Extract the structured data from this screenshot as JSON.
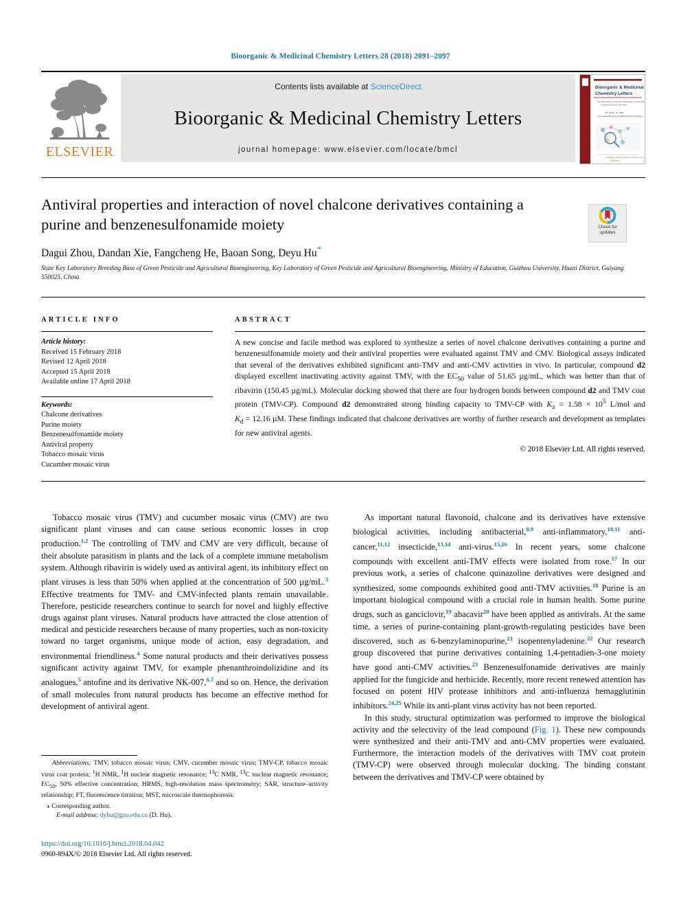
{
  "running_head": "Bioorganic & Medicinal Chemistry Letters 28 (2018) 2091–2097",
  "colors": {
    "link": "#1a72a8",
    "elsevier_orange": "#E87722",
    "sciencedirect_blue": "#3a8dc4",
    "band_gray": "#e6e6e6"
  },
  "masthead": {
    "contents_prefix": "Contents lists available at ",
    "sciencedirect": "ScienceDirect",
    "journal_title": "Bioorganic & Medicinal Chemistry Letters",
    "homepage": "journal homepage: www.elsevier.com/locate/bmcl",
    "publisher": "ELSEVIER",
    "cover_title_line1": "Bioorganic & Medicinal",
    "cover_title_line2": "Chemistry Letters",
    "cover_footer": "Elsevier"
  },
  "article": {
    "title": "Antiviral properties and interaction of novel chalcone derivatives containing a purine and benzenesulfonamide moiety",
    "authors": "Dagui Zhou, Dandan Xie, Fangcheng He, Baoan Song, Deyu Hu",
    "corresponding_marker": "*",
    "affiliation": "State Key Laboratory Breeding Base of Green Pesticide and Agricultural Bioengineering, Key Laboratory of Green Pesticide and Agricultural Bioengineering, Ministry of Education, Guizhou University, Huaxi District, Guiyang 550025, China",
    "crossmark_label_line1": "Check for",
    "crossmark_label_line2": "updates"
  },
  "article_info": {
    "heading": "ARTICLE INFO",
    "history_label": "Article history:",
    "history": [
      "Received 15 February 2018",
      "Revised 12 April 2018",
      "Accepted 15 April 2018",
      "Available online 17 April 2018"
    ],
    "keywords_label": "Keywords:",
    "keywords": [
      "Chalcone derivatives",
      "Purine moiety",
      "Benzenesulfonamide moiety",
      "Antiviral property",
      "Tobacco mosaic virus",
      "Cucumber mosaic virus"
    ]
  },
  "abstract": {
    "heading": "ABSTRACT",
    "copyright": "© 2018 Elsevier Ltd. All rights reserved."
  },
  "footnotes": {
    "abbreviations_label": "Abbreviations:",
    "corresponding": "Corresponding author.",
    "email_label": "E-mail address:",
    "email": "dyhu@gzu.edu.cn",
    "email_suffix": "(D. Hu).",
    "doi": "https://doi.org/10.1016/j.bmcl.2018.04.042",
    "issn_line": "0960-894X/© 2018 Elsevier Ltd. All rights reserved."
  }
}
